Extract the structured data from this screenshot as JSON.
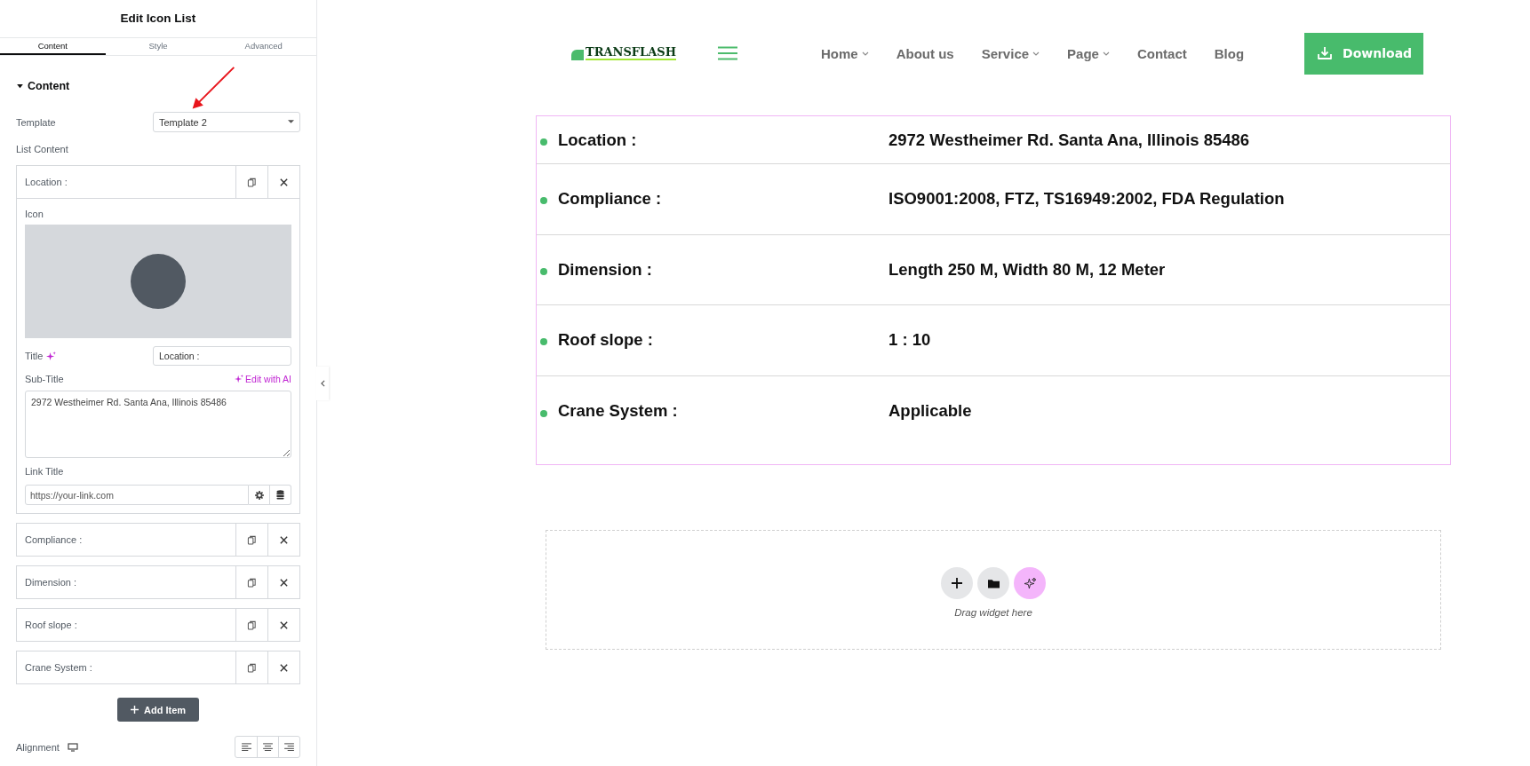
{
  "panel": {
    "title": "Edit Icon List",
    "tabs": [
      {
        "label": "Content",
        "selected": true
      },
      {
        "label": "Style",
        "selected": false
      },
      {
        "label": "Advanced",
        "selected": false
      }
    ],
    "section": {
      "title": "Content",
      "expanded": true
    },
    "template": {
      "label": "Template",
      "value": "Template 2"
    },
    "list_label": "List Content",
    "items": [
      {
        "title": "Location :",
        "details": {
          "icon_label": "Icon",
          "title_label": "Title",
          "title_value": "Location :",
          "subtitle_label": "Sub-Title",
          "ai_link": "Edit with AI",
          "subtitle_value": "2972 Westheimer Rd. Santa Ana, Illinois 85486",
          "link_label": "Link Title",
          "link_placeholder": "https://your-link.com"
        }
      },
      {
        "title": "Compliance :"
      },
      {
        "title": "Dimension :"
      },
      {
        "title": "Roof slope :"
      },
      {
        "title": "Crane System :"
      }
    ],
    "add_button": "Add Item",
    "alignment_label": "Alignment"
  },
  "site": {
    "logo": "TRANSFLASH",
    "nav": [
      {
        "label": "Home",
        "dropdown": true
      },
      {
        "label": "About us",
        "dropdown": false
      },
      {
        "label": "Service",
        "dropdown": true
      },
      {
        "label": "Page",
        "dropdown": true
      },
      {
        "label": "Contact",
        "dropdown": false
      },
      {
        "label": "Blog",
        "dropdown": false
      }
    ],
    "download": "Download"
  },
  "icon_list": [
    {
      "title": "Location :",
      "subtitle": "2972 Westheimer Rd. Santa Ana, Illinois 85486"
    },
    {
      "title": "Compliance :",
      "subtitle": "ISO9001:2008, FTZ, TS16949:2002, FDA Regulation"
    },
    {
      "title": "Dimension :",
      "subtitle": "Length 250 M, Width 80 M, 12 Meter"
    },
    {
      "title": "Roof slope :",
      "subtitle": "1 : 10"
    },
    {
      "title": "Crane System :",
      "subtitle": "Applicable"
    }
  ],
  "dropzone": {
    "hint": "Drag widget here"
  }
}
